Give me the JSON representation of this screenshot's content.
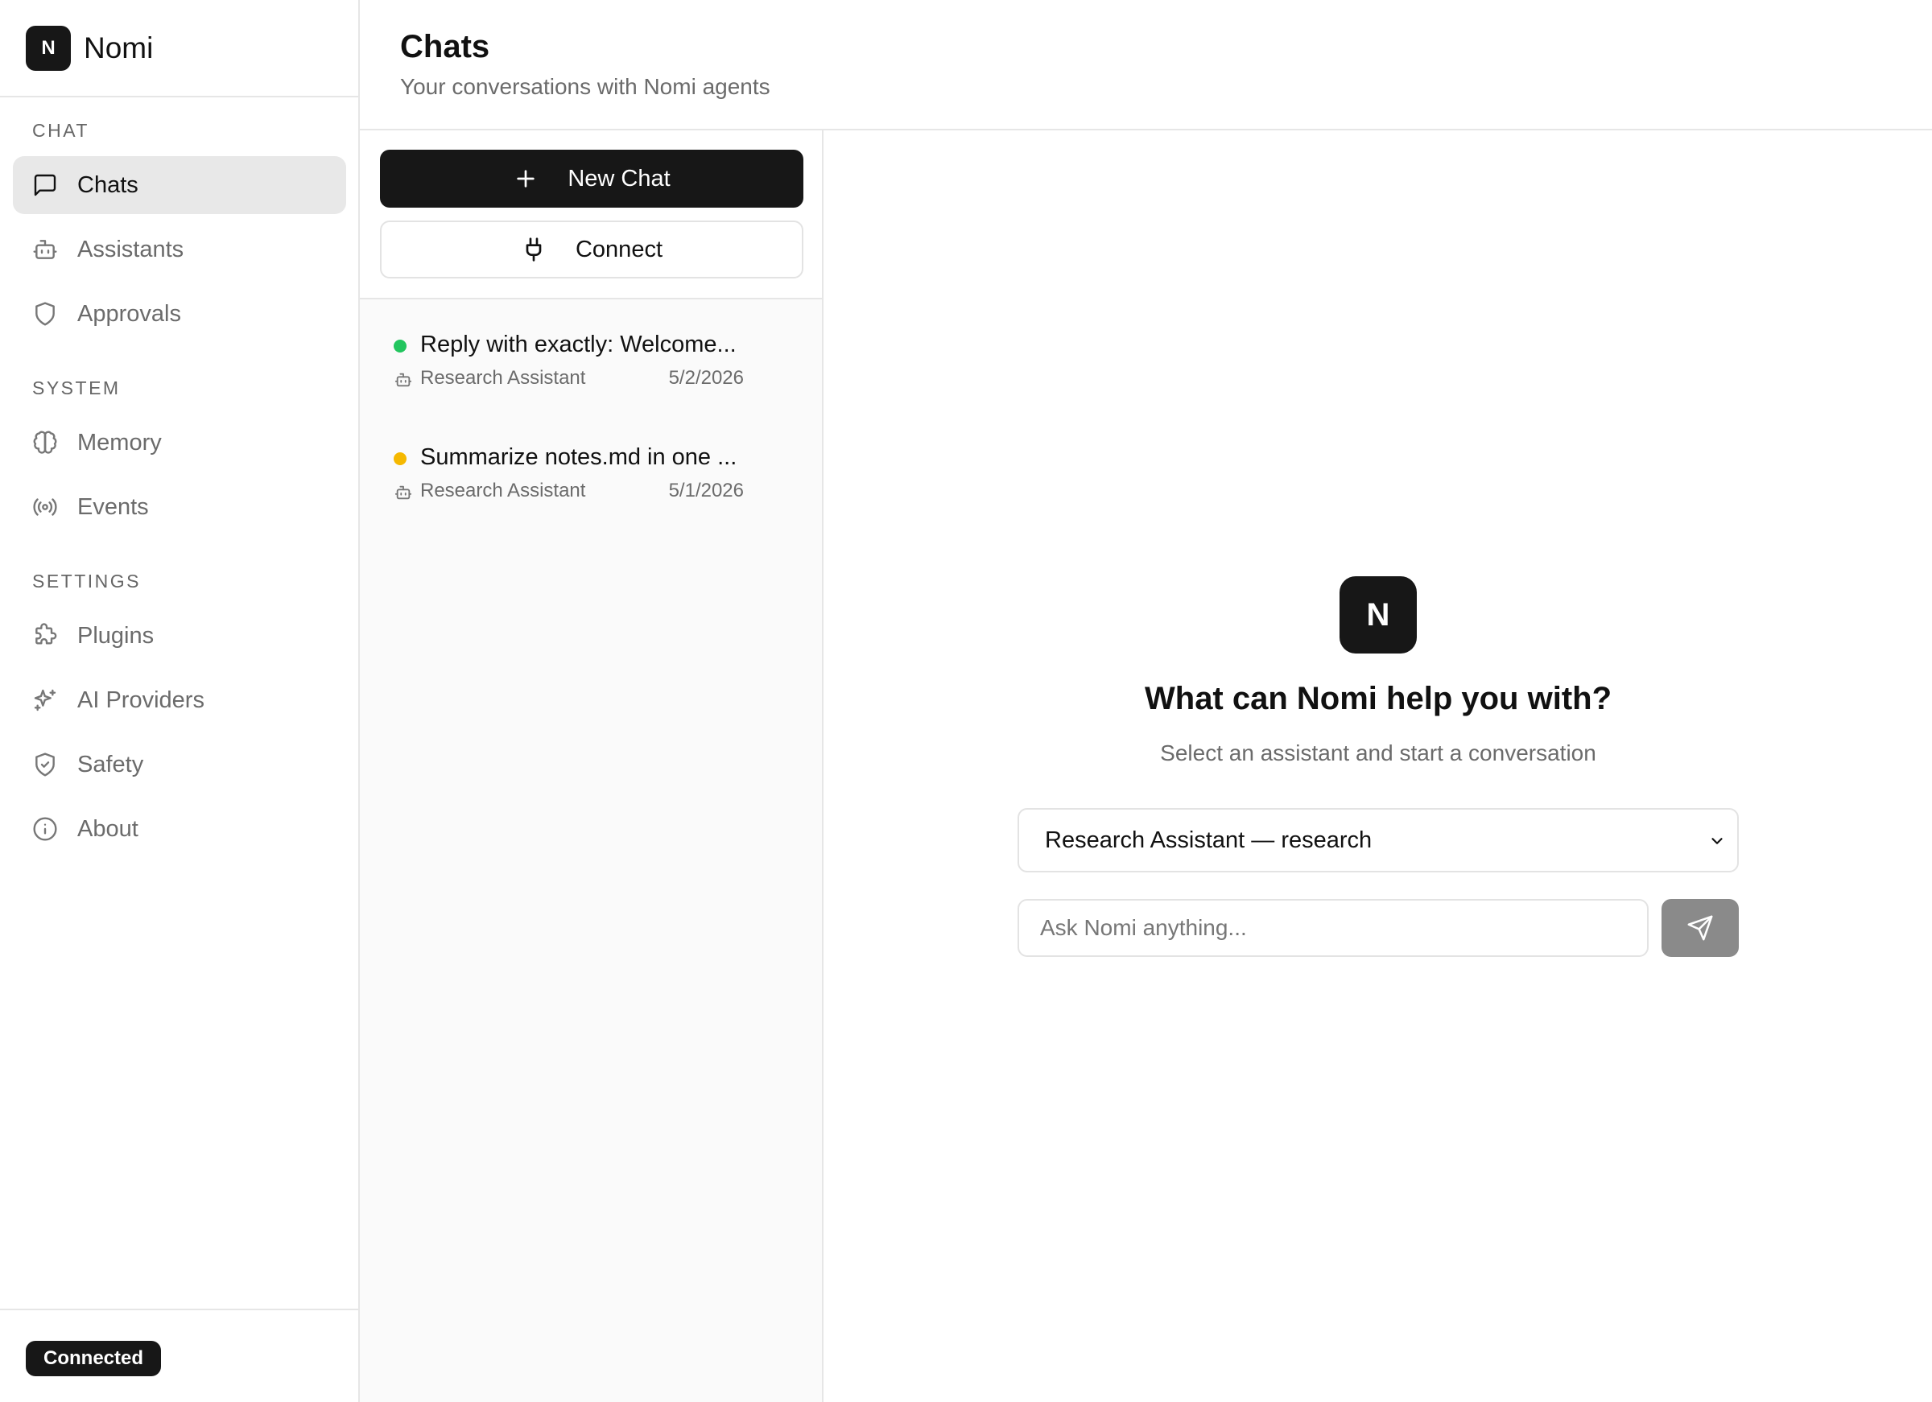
{
  "app": {
    "logo_letter": "N",
    "name": "Nomi"
  },
  "sidebar": {
    "sections": [
      {
        "title": "CHAT"
      },
      {
        "title": "SYSTEM"
      },
      {
        "title": "SETTINGS"
      }
    ],
    "items": [
      {
        "label": "Chats",
        "icon": "message-square-icon",
        "active": true
      },
      {
        "label": "Assistants",
        "icon": "bot-icon"
      },
      {
        "label": "Approvals",
        "icon": "shield-icon"
      },
      {
        "label": "Memory",
        "icon": "brain-icon"
      },
      {
        "label": "Events",
        "icon": "radio-icon"
      },
      {
        "label": "Plugins",
        "icon": "puzzle-icon"
      },
      {
        "label": "AI Providers",
        "icon": "sparkles-icon"
      },
      {
        "label": "Safety",
        "icon": "shield-check-icon"
      },
      {
        "label": "About",
        "icon": "info-icon"
      }
    ],
    "status": "Connected"
  },
  "header": {
    "title": "Chats",
    "subtitle": "Your conversations with Nomi agents"
  },
  "chat_list": {
    "new_chat_label": "New Chat",
    "connect_label": "Connect",
    "chats": [
      {
        "title": "Reply with exactly: Welcome...",
        "assistant": "Research Assistant",
        "date": "5/2/2026",
        "status_color": "#22c55e"
      },
      {
        "title": "Summarize notes.md in one ...",
        "assistant": "Research Assistant",
        "date": "5/1/2026",
        "status_color": "#f5b800"
      }
    ]
  },
  "main": {
    "logo_letter": "N",
    "title": "What can Nomi help you with?",
    "subtitle": "Select an assistant and start a conversation",
    "assistant_select": "Research Assistant — research",
    "input_placeholder": "Ask Nomi anything..."
  }
}
